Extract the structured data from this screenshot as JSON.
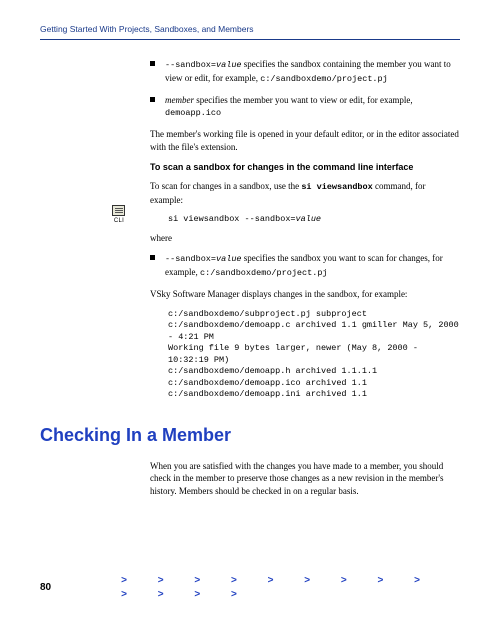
{
  "header": "Getting Started With Projects, Sandboxes, and Members",
  "bullet1": {
    "code": "--sandbox=",
    "codeItalic": "value",
    "rest1": " specifies the sandbox containing the member you want to view or edit, for example, ",
    "path": "c:/sandboxdemo/project.pj"
  },
  "bullet2": {
    "member": "member",
    "rest": " specifies the member you want to view or edit, for example, ",
    "path": "demoapp.ico"
  },
  "para1": "The member's working file is opened in your default editor, or in the editor associated with the file's extension.",
  "cliLabel": "CLI",
  "heading1": "To scan a sandbox for changes in the command line interface",
  "scanPara1a": "To scan for changes in a sandbox, use the ",
  "scanCmd": "si viewsandbox",
  "scanPara1b": " command, for example:",
  "codeExample": "si viewsandbox --sandbox=",
  "codeExampleItalic": "value",
  "where": "where",
  "bullet3": {
    "code": "--sandbox=",
    "codeItalic": "value",
    "rest": " specifies the sandbox you want to scan for changes, for example, ",
    "path": "c:/sandboxdemo/project.pj"
  },
  "para2": "VSky Software Manager displays changes in the sandbox, for example:",
  "output": [
    "c:/sandboxdemo/subproject.pj subproject",
    "c:/sandboxdemo/demoapp.c archived 1.1 gmiller May 5, 2000 - 4:21 PM",
    "Working file 9 bytes larger, newer (May 8, 2000 - 10:32:19 PM)",
    "c:/sandboxdemo/demoapp.h archived 1.1.1.1",
    "c:/sandboxdemo/demoapp.ico archived 1.1",
    "c:/sandboxdemo/demoapp.ini archived 1.1"
  ],
  "sectionTitle": "Checking In a Member",
  "sectionPara": "When you are satisfied with the changes you have made to a member, you should check in the member to preserve those changes as a new revision in the member's history. Members should be checked in on a regular basis.",
  "pageNumber": "80",
  "chevrons": ">  >  >  >  >  >  >  >  >  >  >  >  >"
}
